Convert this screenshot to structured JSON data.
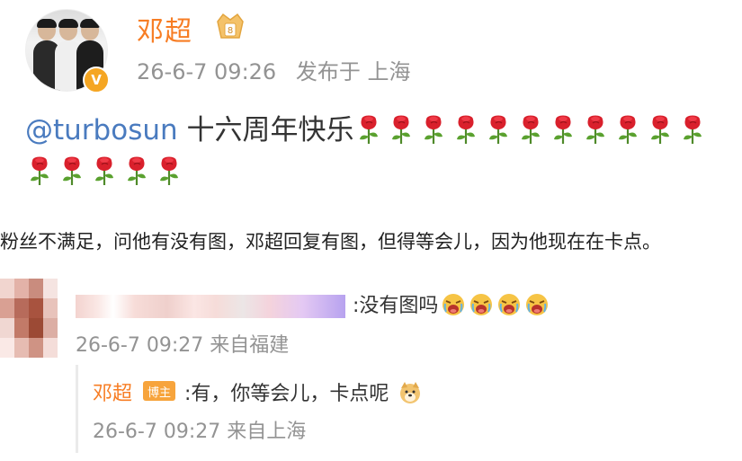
{
  "post": {
    "author": "邓超",
    "timestamp": "26-6-7 09:26",
    "published_label": "发布于 上海",
    "mention": "@turbosun",
    "text": " 十六周年快乐",
    "rose_count": 16,
    "verified_mark": "V"
  },
  "caption": "粉丝不满足，问他有没有图，邓超回复有图，但得等会儿，因为他现在在卡点。",
  "comments": {
    "first": {
      "author": "",
      "text": ":没有图吗",
      "emoji_count": 4,
      "timestamp": "26-6-7 09:27",
      "location": "来自福建"
    },
    "reply": {
      "author": "邓超",
      "badge": "博主",
      "text": ":有，你等会儿，卡点呢",
      "timestamp": "26-6-7 09:27",
      "location": "来自上海"
    }
  },
  "colors": {
    "name": "#f77d24",
    "mention": "#4a7bbf",
    "meta": "#939393",
    "badge": "#f7a43c"
  }
}
